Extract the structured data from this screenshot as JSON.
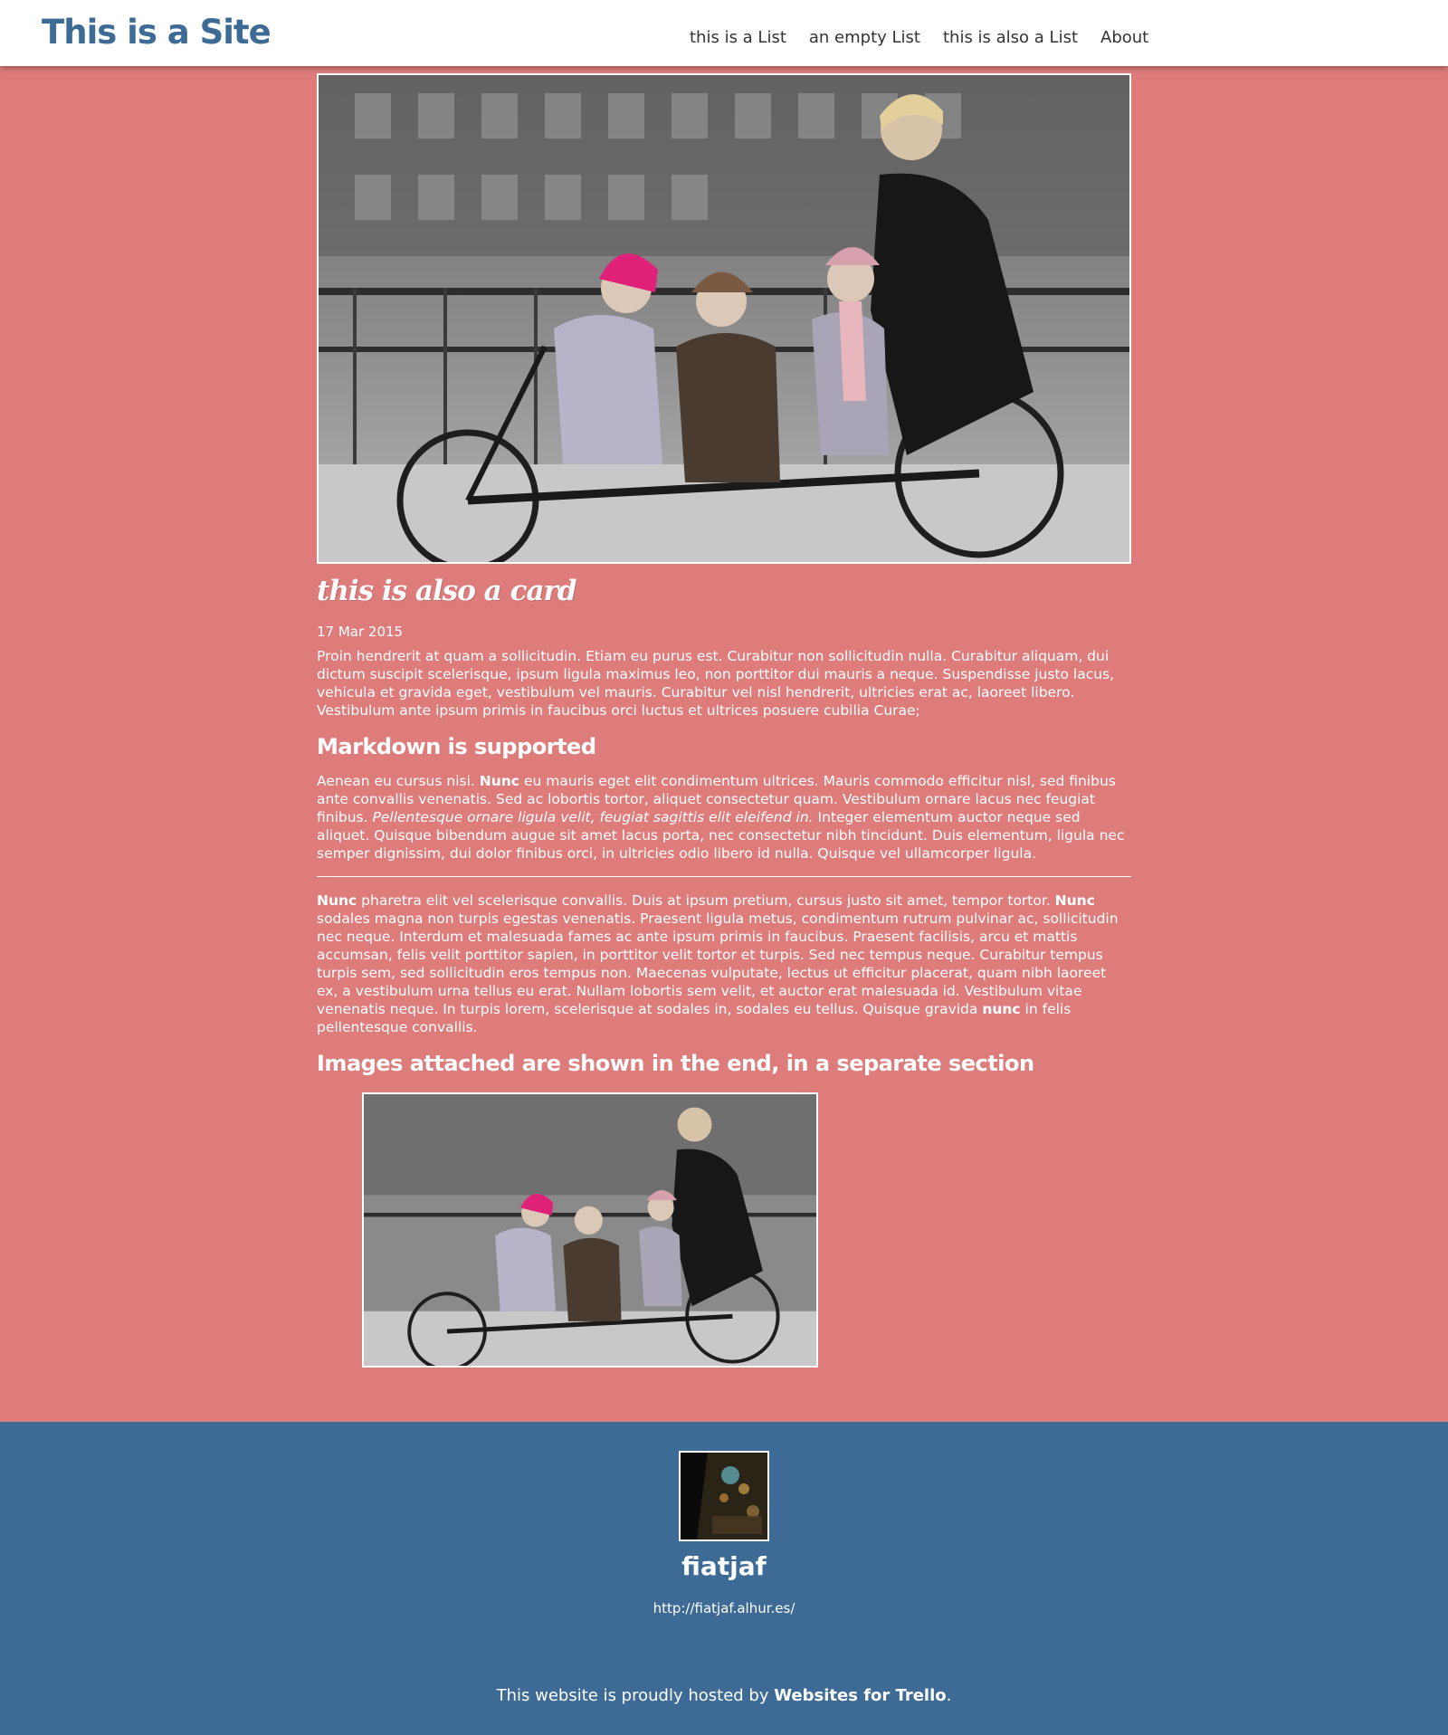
{
  "header": {
    "site_title": "This is a Site",
    "nav": [
      "this is a List",
      "an empty List",
      "this is also a List",
      "About"
    ]
  },
  "card": {
    "cover_alt": "family riding a long tandem bicycle",
    "title": "this is also a card",
    "date": "17 Mar 2015",
    "description": "Proin hendrerit at quam a sollicitudin. Etiam eu purus est. Curabitur non sollicitudin nulla. Curabitur aliquam, dui dictum suscipit scelerisque, ipsum ligula maximus leo, non porttitor dui mauris a neque. Suspendisse justo lacus, vehicula et gravida eget, vestibulum vel mauris. Curabitur vel nisl hendrerit, ultricies erat ac, laoreet libero. Vestibulum ante ipsum primis in faucibus orci luctus et ultrices posuere cubilia Curae;",
    "heading_markdown": "Markdown is supported",
    "para1": {
      "t1": "Aenean eu cursus nisi. ",
      "b1": "Nunc",
      "t2": " eu mauris eget elit condimentum ultrices. Mauris commodo efficitur nisl, sed finibus ante convallis venenatis. Sed ac lobortis tortor, aliquet consectetur quam. Vestibulum ornare lacus nec feugiat finibus. ",
      "i1": "Pellentesque ornare ligula velit, feugiat sagittis elit eleifend in.",
      "t3": " Integer elementum auctor neque sed aliquet. Quisque bibendum augue sit amet lacus porta, nec consectetur nibh tincidunt. Duis elementum, ligula nec semper dignissim, dui dolor finibus orci, in ultricies odio libero id nulla. Quisque vel ullamcorper ligula."
    },
    "para2": {
      "b1": "Nunc",
      "t1": " pharetra elit vel scelerisque convallis. Duis at ipsum pretium, cursus justo sit amet, tempor tortor. ",
      "b2": "Nunc",
      "t2": " sodales magna non turpis egestas venenatis. Praesent ligula metus, condimentum rutrum pulvinar ac, sollicitudin nec neque. Interdum et malesuada fames ac ante ipsum primis in faucibus. Praesent facilisis, arcu et mattis accumsan, felis velit porttitor sapien, in porttitor velit tortor et turpis. Sed nec tempus neque. Curabitur tempus turpis sem, sed sollicitudin eros tempus non. Maecenas vulputate, lectus ut efficitur placerat, quam nibh laoreet ex, a vestibulum urna tellus eu erat. Nullam lobortis sem velit, et auctor erat malesuada id. Vestibulum vitae venenatis neque. In turpis lorem, scelerisque at sodales in, sodales eu tellus. Quisque gravida ",
      "b3": "nunc",
      "t3": " in felis pellentesque convallis."
    },
    "heading_images": "Images attached are shown in the end, in a separate section"
  },
  "footer": {
    "author_name": "fiatjaf",
    "author_url": "http://fiatjaf.alhur.es/",
    "hosted_prefix": "This website is proudly hosted by ",
    "hosted_link": "Websites for Trello",
    "hosted_suffix": "."
  },
  "colors": {
    "background": "#de7c7c",
    "footer": "#3d6b96",
    "title": "#3d6b96"
  }
}
